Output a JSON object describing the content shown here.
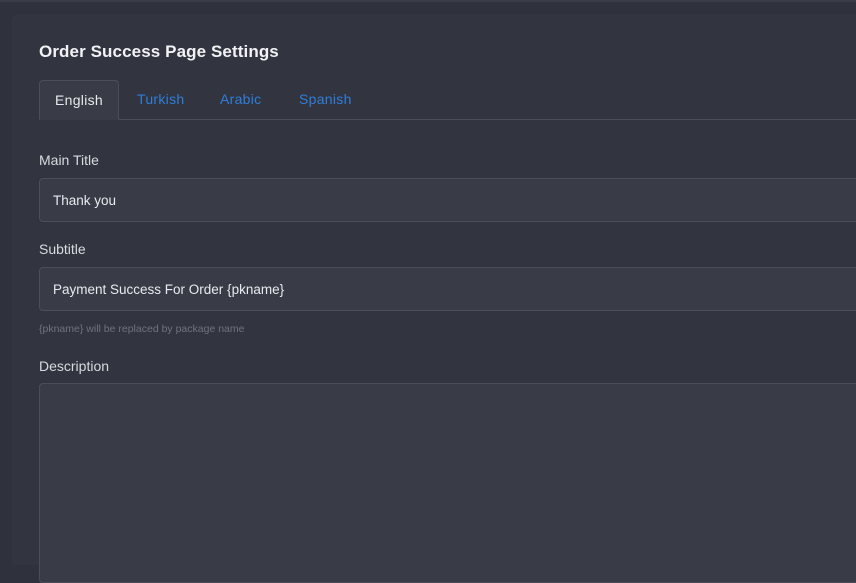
{
  "page": {
    "title": "Order Success Page Settings"
  },
  "tabs": [
    {
      "label": "English",
      "active": true
    },
    {
      "label": "Turkish",
      "active": false
    },
    {
      "label": "Arabic",
      "active": false
    },
    {
      "label": "Spanish",
      "active": false
    }
  ],
  "form": {
    "main_title": {
      "label": "Main Title",
      "value": "Thank you"
    },
    "subtitle": {
      "label": "Subtitle",
      "value": "Payment Success For Order {pkname}",
      "help": "{pkname} will be replaced by package name"
    },
    "description": {
      "label": "Description",
      "value": ""
    }
  },
  "colors": {
    "background": "#2f323c",
    "card": "#32353f",
    "input": "#393c47",
    "accent": "#2f7ddb"
  }
}
